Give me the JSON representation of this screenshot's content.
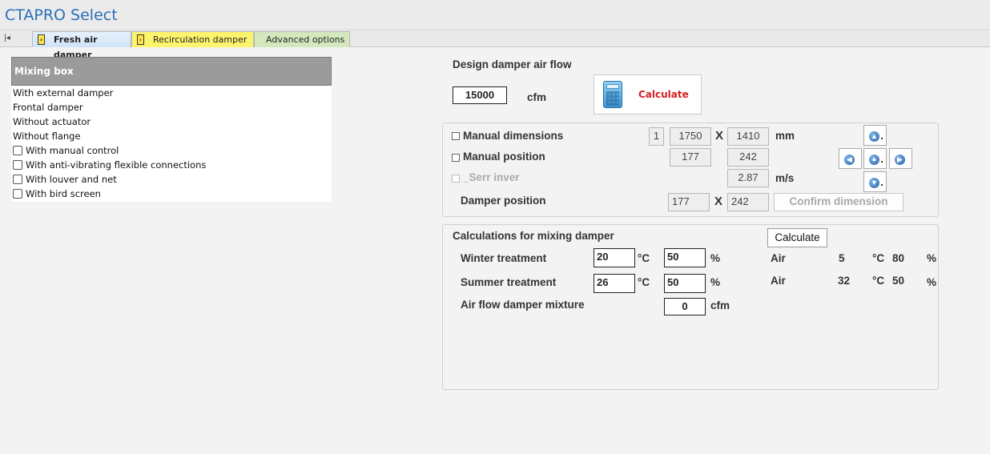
{
  "app": {
    "title": "CTAPRO Select"
  },
  "tabs": [
    {
      "label": "Fresh air damper"
    },
    {
      "label": "Recirculation damper"
    },
    {
      "label": "Advanced options"
    }
  ],
  "mixing_box": {
    "header": "Mixing box",
    "info_rows": [
      "With external damper",
      "Frontal damper",
      "Without actuator",
      "Without flange"
    ],
    "check_rows": [
      "With manual control",
      "With anti-vibrating flexible connections",
      "With louver and  net",
      "With bird screen"
    ]
  },
  "design": {
    "label": "Design damper air flow",
    "airflow_value": "15000",
    "airflow_unit": "cfm",
    "calculate_label": "Calculate"
  },
  "dimensions": {
    "manual_dimensions_label": "Manual dimensions",
    "count": "1",
    "width": "1750",
    "height": "1410",
    "dim_unit": "mm",
    "times_symbol": "X",
    "manual_position_label": "Manual position",
    "pos_x": "177",
    "pos_y": "242",
    "serr_label": "_Serr inver",
    "velocity": "2.87",
    "velocity_unit": "m/s",
    "damper_position_label": "Damper position",
    "damper_x": "177",
    "damper_y": "242",
    "confirm_label": "Confirm dimension"
  },
  "mixing_calc": {
    "title": "Calculations for mixing damper",
    "calculate_label": "Calculate",
    "winter_label": "Winter treatment",
    "winter_temp": "20",
    "winter_hum": "50",
    "summer_label": "Summer treatment",
    "summer_temp": "26",
    "summer_hum": "50",
    "temp_unit": "°C",
    "hum_unit": "%",
    "air_label": "Air",
    "winter_air_temp": "5",
    "winter_air_hum": "80",
    "summer_air_temp": "32",
    "summer_air_hum": "50",
    "mixture_label": "Air flow damper mixture",
    "mixture_value": "0",
    "mixture_unit": "cfm"
  }
}
